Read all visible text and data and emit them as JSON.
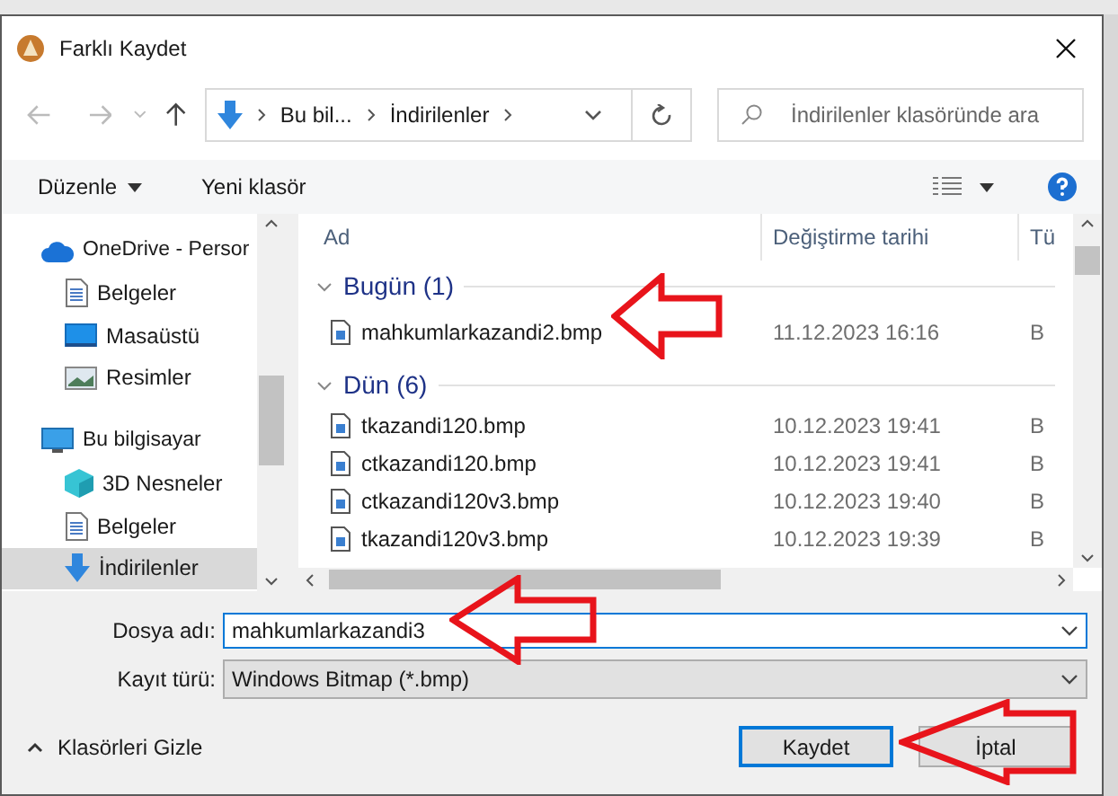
{
  "window": {
    "title": "Farklı Kaydet"
  },
  "address_bar": {
    "crumbs": [
      "Bu bil...",
      "İndirilenler"
    ]
  },
  "search": {
    "placeholder": "İndirilenler klasöründe ara"
  },
  "toolbar": {
    "organize": "Düzenle",
    "new_folder": "Yeni klasör"
  },
  "sidebar": {
    "items": [
      {
        "label": "OneDrive - Persor",
        "kind": "cloud",
        "selected": false,
        "children": [
          {
            "label": "Belgeler",
            "kind": "document",
            "selected": false
          },
          {
            "label": "Masaüstü",
            "kind": "desktop",
            "selected": false
          },
          {
            "label": "Resimler",
            "kind": "pictures",
            "selected": false
          }
        ]
      },
      {
        "label": "Bu bilgisayar",
        "kind": "computer",
        "selected": false,
        "children": [
          {
            "label": "3D Nesneler",
            "kind": "cube",
            "selected": false
          },
          {
            "label": "Belgeler",
            "kind": "document",
            "selected": false
          },
          {
            "label": "İndirilenler",
            "kind": "download",
            "selected": true
          }
        ]
      }
    ]
  },
  "file_list": {
    "columns": [
      "Ad",
      "Değiştirme tarihi",
      "Tü"
    ],
    "groups": [
      {
        "label": "Bugün (1)",
        "expanded": true,
        "files": [
          {
            "name": "mahkumlarkazandi2.bmp",
            "date": "11.12.2023 16:16",
            "type": "B"
          }
        ]
      },
      {
        "label": "Dün (6)",
        "expanded": true,
        "files": [
          {
            "name": "tkazandi120.bmp",
            "date": "10.12.2023 19:41",
            "type": "B"
          },
          {
            "name": "ctkazandi120.bmp",
            "date": "10.12.2023 19:41",
            "type": "B"
          },
          {
            "name": "ctkazandi120v3.bmp",
            "date": "10.12.2023 19:40",
            "type": "B"
          },
          {
            "name": "tkazandi120v3.bmp",
            "date": "10.12.2023 19:39",
            "type": "B"
          }
        ]
      }
    ]
  },
  "form": {
    "filename_label": "Dosya adı:",
    "filename": "mahkumlarkazandi3",
    "type_label": "Kayıt türü:",
    "type": "Windows Bitmap (*.bmp)"
  },
  "hide_folders": "Klasörleri Gizle",
  "buttons": [
    {
      "label": "Kaydet",
      "default": true
    },
    {
      "label": "İptal",
      "default": false
    }
  ]
}
